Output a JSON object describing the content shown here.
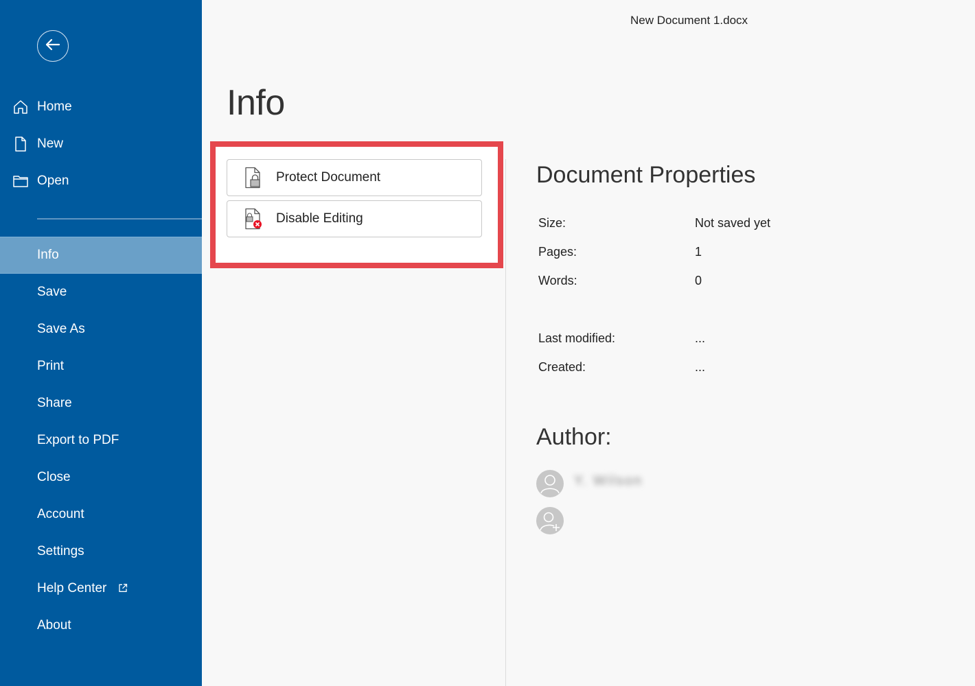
{
  "window": {
    "title": "New Document 1.docx"
  },
  "sidebar": {
    "items": [
      {
        "label": "Home",
        "icon": "home-icon"
      },
      {
        "label": "New",
        "icon": "new-file-icon"
      },
      {
        "label": "Open",
        "icon": "folder-icon"
      },
      {
        "label": "Info",
        "active": true
      },
      {
        "label": "Save"
      },
      {
        "label": "Save As"
      },
      {
        "label": "Print"
      },
      {
        "label": "Share"
      },
      {
        "label": "Export to PDF"
      },
      {
        "label": "Close"
      },
      {
        "label": "Account"
      },
      {
        "label": "Settings"
      },
      {
        "label": "Help Center",
        "icon": "external-link-icon"
      },
      {
        "label": "About"
      }
    ]
  },
  "main": {
    "heading": "Info",
    "actions": [
      {
        "label": "Protect Document",
        "icon": "lock-document-icon"
      },
      {
        "label": "Disable Editing",
        "icon": "disable-editing-icon"
      }
    ],
    "properties": {
      "heading": "Document Properties",
      "rows": [
        {
          "label": "Size:",
          "value": "Not saved yet"
        },
        {
          "label": "Pages:",
          "value": "1"
        },
        {
          "label": "Words:",
          "value": "0"
        },
        {
          "label": "Last modified:",
          "value": "..."
        },
        {
          "label": "Created:",
          "value": "..."
        }
      ]
    },
    "author": {
      "heading": "Author:",
      "name": "Y. Wilson"
    }
  },
  "colors": {
    "sidebar": "#005a9e",
    "sidebar_active": "#6aa0c8",
    "highlight": "#e5474d",
    "error_badge": "#e81123"
  }
}
